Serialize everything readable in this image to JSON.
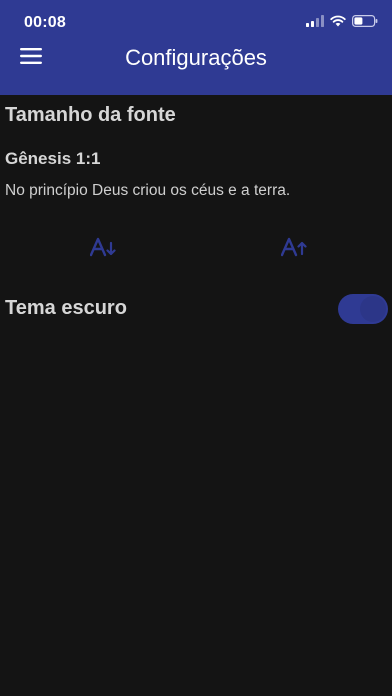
{
  "status_bar": {
    "time": "00:08",
    "icons": [
      "cellular-signal-icon",
      "wifi-icon",
      "battery-icon"
    ]
  },
  "header": {
    "title": "Configurações",
    "menu_icon": "hamburger-menu-icon",
    "background_color": "#2f3a93"
  },
  "font_size": {
    "section_title": "Tamanho da fonte",
    "preview_reference": "Gênesis 1:1",
    "preview_text": "No princípio Deus criou os céus e a terra.",
    "decrease_icon": "font-size-decrease-icon",
    "increase_icon": "font-size-increase-icon"
  },
  "dark_theme": {
    "label": "Tema escuro",
    "enabled": true,
    "toggle_color": "#2f3a93"
  },
  "colors": {
    "background": "#141414",
    "accent": "#2f3a93",
    "text": "#d6d6d6"
  }
}
